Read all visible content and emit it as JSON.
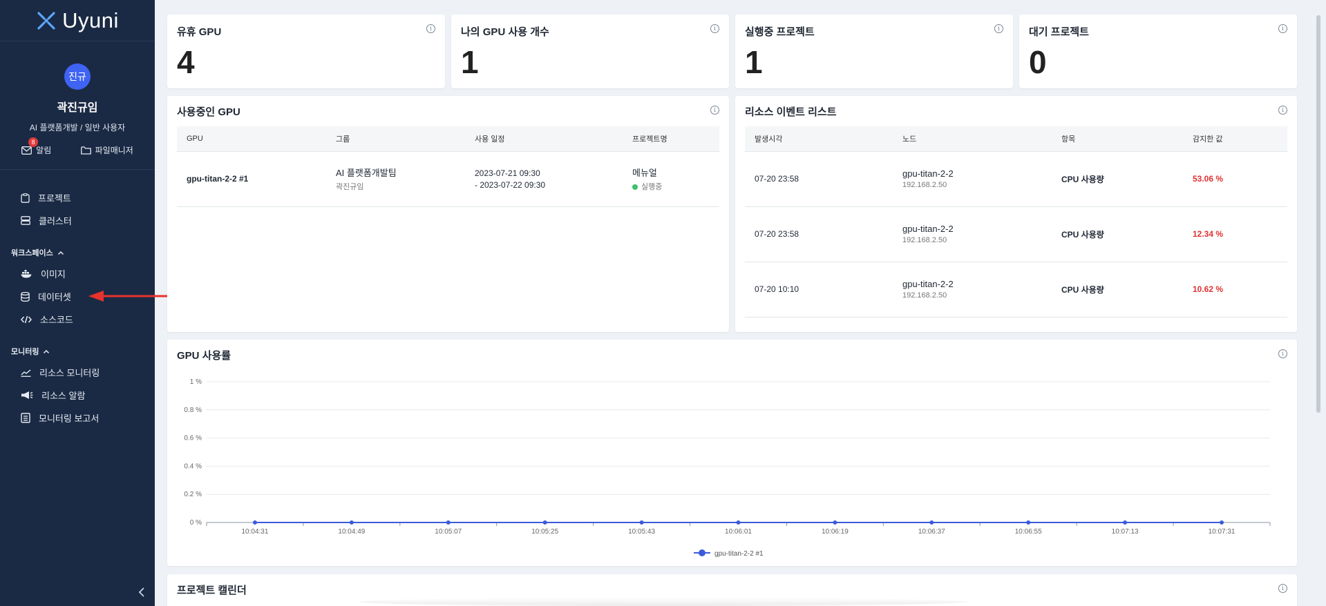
{
  "app": {
    "logo_text": "Uyuni"
  },
  "user": {
    "avatar_text": "진규",
    "name": "곽진규임",
    "role": "AI 플랫폼개발 / 일반 사용자",
    "alerts_label": "알림",
    "alerts_count": "8",
    "files_label": "파일매니저"
  },
  "menu": {
    "project": "프로젝트",
    "cluster": "클러스터",
    "workspace_section": "워크스페이스",
    "image": "이미지",
    "dataset": "데이터셋",
    "sourcecode": "소스코드",
    "monitoring_section": "모니터링",
    "resource_monitoring": "리소스 모니터링",
    "resource_alarm": "리소스 알람",
    "monitoring_report": "모니터링 보고서"
  },
  "stats": [
    {
      "title": "유휴 GPU",
      "value": "4"
    },
    {
      "title": "나의 GPU 사용 개수",
      "value": "1"
    },
    {
      "title": "실행중 프로젝트",
      "value": "1"
    },
    {
      "title": "대기 프로젝트",
      "value": "0"
    }
  ],
  "gpu_in_use": {
    "title": "사용중인 GPU",
    "headers": [
      "GPU",
      "그룹",
      "사용 일정",
      "프로젝트명"
    ],
    "rows": [
      {
        "gpu": "gpu-titan-2-2 #1",
        "group": "AI 플랫폼개발팀",
        "group_user": "곽진규임",
        "schedule_start": "2023-07-21 09:30",
        "schedule_end": "- 2023-07-22 09:30",
        "project": "메뉴얼",
        "status": "실행중"
      }
    ]
  },
  "events": {
    "title": "리소스 이벤트 리스트",
    "headers": [
      "발생시각",
      "노드",
      "항목",
      "감지한 값"
    ],
    "rows": [
      {
        "time": "07-20 23:58",
        "node": "gpu-titan-2-2",
        "ip": "192.168.2.50",
        "item": "CPU 사용량",
        "value": "53.06 %"
      },
      {
        "time": "07-20 23:58",
        "node": "gpu-titan-2-2",
        "ip": "192.168.2.50",
        "item": "CPU 사용량",
        "value": "12.34 %"
      },
      {
        "time": "07-20 10:10",
        "node": "gpu-titan-2-2",
        "ip": "192.168.2.50",
        "item": "CPU 사용량",
        "value": "10.62 %"
      }
    ]
  },
  "gpu_usage": {
    "title": "GPU 사용률"
  },
  "calendar": {
    "title": "프로젝트 캘린더"
  },
  "colors": {
    "sidebar": "#1b2a44",
    "accent": "#3f63f3",
    "alert": "#e03131",
    "series": "#3b5bdb"
  },
  "chart_data": {
    "type": "line",
    "title": "GPU 사용률",
    "x": [
      "10:04:31",
      "10:04:49",
      "10:05:07",
      "10:05:25",
      "10:05:43",
      "10:06:01",
      "10:06:19",
      "10:06:37",
      "10:06:55",
      "10:07:13",
      "10:07:31"
    ],
    "yticks": [
      "0 %",
      "0.2 %",
      "0.4 %",
      "0.6 %",
      "0.8 %",
      "1 %"
    ],
    "ylim": [
      0,
      1
    ],
    "grid": true,
    "legend": "bottom",
    "series": [
      {
        "name": "gpu-titan-2-2 #1",
        "values": [
          0,
          0,
          0,
          0,
          0,
          0,
          0,
          0,
          0,
          0,
          0
        ]
      }
    ]
  }
}
